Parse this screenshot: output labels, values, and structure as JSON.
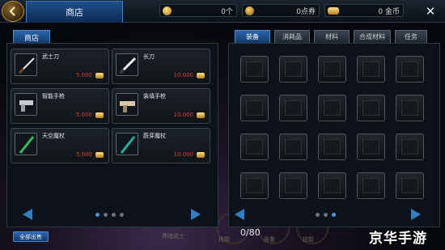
{
  "header": {
    "title": "商店",
    "resources": [
      {
        "icon": "coin-icon",
        "value": "0个"
      },
      {
        "icon": "ticket-icon",
        "value": "0点券"
      },
      {
        "icon": "gold-icon",
        "value": "0 金币"
      }
    ],
    "close_label": "✕"
  },
  "left_panel": {
    "tab_label": "商店",
    "items": [
      {
        "name": "武士刀",
        "price": "5.000",
        "icon": "katana-icon"
      },
      {
        "name": "长刀",
        "price": "10.000",
        "icon": "long-blade-icon"
      },
      {
        "name": "智能手枪",
        "price": "5.000",
        "icon": "smart-pistol-icon"
      },
      {
        "name": "装填手枪",
        "price": "10.000",
        "icon": "reload-pistol-icon"
      },
      {
        "name": "天空魔杖",
        "price": "5.000",
        "icon": "sky-wand-icon"
      },
      {
        "name": "蔚芽魔杖",
        "price": "10.000",
        "icon": "sprout-wand-icon"
      }
    ],
    "pager": {
      "pages": 4,
      "current": 1
    },
    "sell_all_label": "全部出售"
  },
  "right_panel": {
    "tabs": [
      {
        "label": "装备",
        "active": true
      },
      {
        "label": "消耗品",
        "active": false
      },
      {
        "label": "材料",
        "active": false
      },
      {
        "label": "合成材料",
        "active": false
      },
      {
        "label": "任务",
        "active": false
      }
    ],
    "slot_rows": 4,
    "slot_cols": 5,
    "capacity": "0/80"
  },
  "background": {
    "ghost_texts": [
      "黑暗武士",
      "技能",
      "装备",
      "技能"
    ]
  },
  "watermark": "京华手游",
  "colors": {
    "accent_blue": "#2a64a8",
    "price_red": "#e0403a",
    "gold": "#ffd060"
  }
}
